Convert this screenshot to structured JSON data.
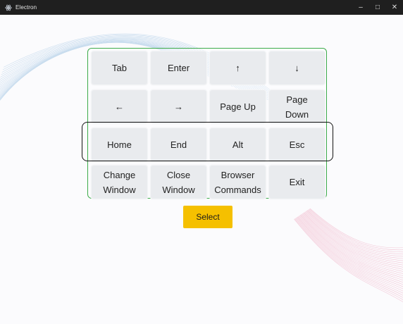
{
  "window": {
    "title": "Electron",
    "minimize_glyph": "–",
    "maximize_glyph": "□",
    "close_glyph": "✕"
  },
  "keypad": {
    "selected_row": 2,
    "rows": [
      [
        "Tab",
        "Enter",
        "↑",
        "↓"
      ],
      [
        "←",
        "→",
        "Page Up",
        "Page\nDown"
      ],
      [
        "Home",
        "End",
        "Alt",
        "Esc"
      ],
      [
        "Change\nWindow",
        "Close\nWindow",
        "Browser\nCommands",
        "Exit"
      ]
    ]
  },
  "select_button": {
    "label": "Select"
  },
  "colors": {
    "keypad_border": "#3cab4a",
    "key_background": "#e9ebee",
    "select_button": "#f5c000",
    "selection_outline": "#111111"
  }
}
